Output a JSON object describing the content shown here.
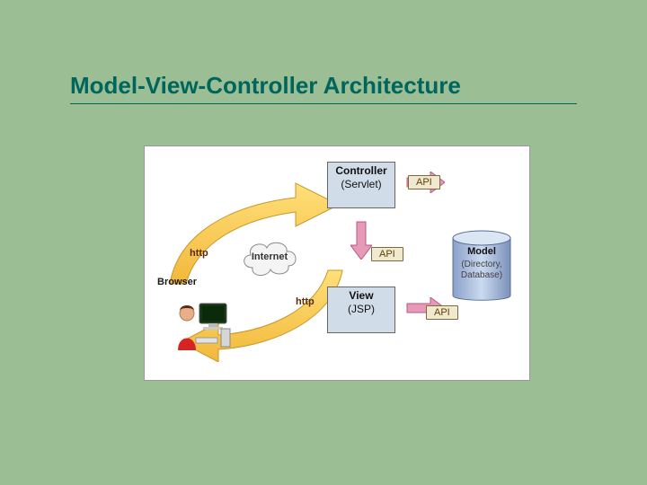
{
  "title": "Model-View-Controller Architecture",
  "labels": {
    "http1": "http",
    "http2": "http",
    "browser": "Browser",
    "internet": "Internet"
  },
  "api": {
    "a1": "API",
    "a2": "API",
    "a3": "API"
  },
  "controller": {
    "name": "Controller",
    "impl": "(Servlet)"
  },
  "view": {
    "name": "View",
    "impl": "(JSP)"
  },
  "model": {
    "name": "Model",
    "detail1": "(Directory,",
    "detail2": "Database)"
  }
}
